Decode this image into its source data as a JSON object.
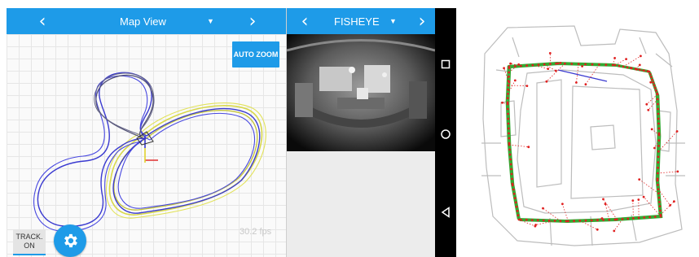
{
  "map_view": {
    "title": "Map View",
    "prev_icon": "chevron-left",
    "next_icon": "chevron-right",
    "dropdown_icon": "caret-down",
    "auto_zoom_label": "AUTO ZOOM",
    "fps_text": "30.2 fps",
    "track_button": {
      "line1": "TRACK.",
      "line2": "ON"
    },
    "settings_icon": "gear",
    "accent_color": "#1e9be8",
    "trajectory_colors": {
      "run_a": "#3a3ad0",
      "run_b": "#d8d84a",
      "run_c": "#555577"
    }
  },
  "camera_view": {
    "title": "FISHEYE",
    "prev_icon": "chevron-left",
    "next_icon": "chevron-right",
    "dropdown_icon": "caret-down"
  },
  "android_nav": {
    "recent_icon": "square-icon",
    "home_icon": "circle-icon",
    "back_icon": "triangle-icon"
  },
  "floorplan": {
    "path_color": "#33aa33",
    "point_color": "#e02020"
  }
}
